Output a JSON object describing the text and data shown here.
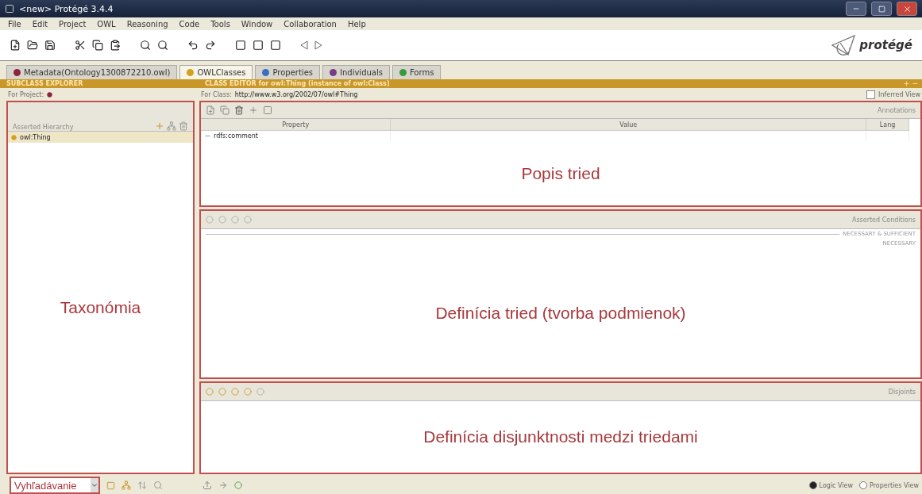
{
  "window": {
    "title": "<new>  Protégé 3.4.4",
    "logo": "protégé"
  },
  "menu": [
    "File",
    "Edit",
    "Project",
    "OWL",
    "Reasoning",
    "Code",
    "Tools",
    "Window",
    "Collaboration",
    "Help"
  ],
  "tabs": [
    {
      "label": "Metadata(Ontology1300872210.owl)",
      "selected": false,
      "color": "#8b2440"
    },
    {
      "label": "OWLClasses",
      "selected": true,
      "color": "#d4a020"
    },
    {
      "label": "Properties",
      "selected": false,
      "color": "#3a6fc0"
    },
    {
      "label": "Individuals",
      "selected": false,
      "color": "#7a3a8a"
    },
    {
      "label": "Forms",
      "selected": false,
      "color": "#3a9a3a"
    }
  ],
  "left": {
    "header": "SUBCLASS EXPLORER",
    "for_project": "For Project:",
    "hierarchy_title": "Asserted Hierarchy",
    "tree": [
      {
        "label": "owl:Thing",
        "selected": true
      }
    ],
    "overlay": "Taxonómia",
    "search": {
      "value": "Vyhľadávanie"
    }
  },
  "right": {
    "header": "CLASS EDITOR for owl:Thing   (instance of owl:Class)",
    "for_class_label": "For Class:",
    "for_class": "http://www.w3.org/2002/07/owl#Thing",
    "inferred_view": {
      "label": "Inferred View",
      "checked": false
    },
    "annotations": {
      "button": "Annotations",
      "columns": [
        "Property",
        "Value",
        "Lang"
      ],
      "rows": [
        {
          "property": "rdfs:comment"
        }
      ],
      "overlay": "Popis tried"
    },
    "conditions": {
      "title": "Asserted Conditions",
      "groups": [
        "NECESSARY & SUFFICIENT",
        "NECESSARY"
      ],
      "overlay": "Definícia tried (tvorba podmienok)"
    },
    "disjoints": {
      "title": "Disjoints",
      "overlay": "Definícia disjunktnosti medzi triedami"
    },
    "view_mode": [
      {
        "label": "Logic View",
        "selected": true
      },
      {
        "label": "Properties View",
        "selected": false
      }
    ]
  }
}
